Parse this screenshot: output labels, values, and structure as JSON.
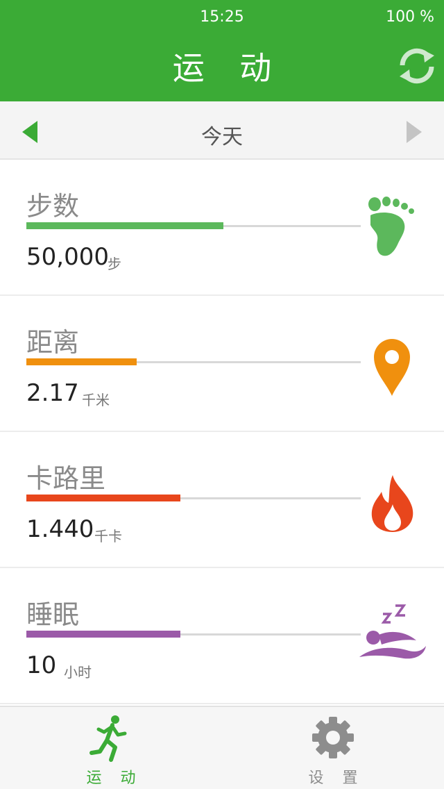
{
  "status": {
    "time": "15:25",
    "battery": "100 %"
  },
  "header": {
    "title": "运 动",
    "refresh_icon": "refresh-icon"
  },
  "datebar": {
    "label": "今天"
  },
  "metrics": [
    {
      "title": "步数",
      "value": "50,000",
      "unit": "步",
      "progress": 0.59,
      "color": "#5cb85c",
      "icon": "footprint-icon"
    },
    {
      "title": "距离",
      "value": "2.17",
      "unit": "千米",
      "progress": 0.33,
      "color": "#f0900e",
      "icon": "location-pin-icon"
    },
    {
      "title": "卡路里",
      "value": "1.440",
      "unit": "千卡",
      "progress": 0.46,
      "color": "#e8461c",
      "icon": "flame-icon"
    },
    {
      "title": "睡眠",
      "value": "10",
      "unit": "小时",
      "progress": 0.46,
      "color": "#9b5aa8",
      "icon": "sleep-icon"
    }
  ],
  "tabs": [
    {
      "label": "运 动",
      "icon": "runner-icon",
      "active": true
    },
    {
      "label": "设 置",
      "icon": "gear-icon",
      "active": false
    }
  ],
  "colors": {
    "brand": "#3bab36",
    "inactive": "#8d8d8d"
  }
}
